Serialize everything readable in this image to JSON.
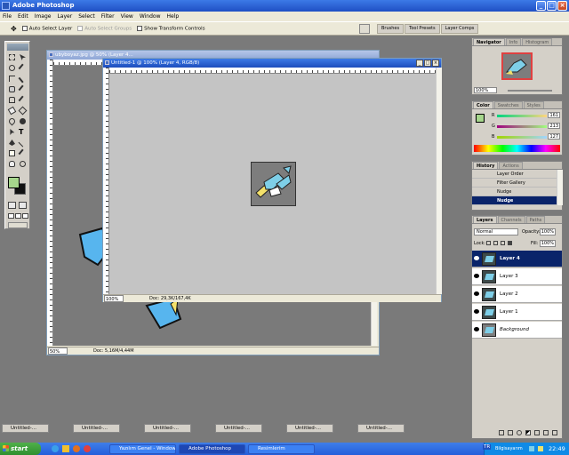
{
  "app": {
    "title": "Adobe Photoshop",
    "controls": {
      "min": "_",
      "max": "□",
      "close": "×"
    }
  },
  "menu": [
    "File",
    "Edit",
    "Image",
    "Layer",
    "Select",
    "Filter",
    "View",
    "Window",
    "Help"
  ],
  "options": {
    "auto_select_layer": "Auto Select Layer",
    "auto_select_groups": "Auto Select Groups",
    "show_transform_controls": "Show Transform Controls",
    "well_tabs": [
      "Brushes",
      "Tool Presets",
      "Layer Comps"
    ]
  },
  "colors": {
    "foreground": "#a6d68c",
    "background": "#111111",
    "canvas": "#c4c4c4",
    "selection": "#0a246a",
    "xp_blue": "#245edb",
    "art_cyan": "#7ecfe8",
    "art_yellow": "#f3e06a"
  },
  "doc_back": {
    "title": "ubyboyaz.jpg @ 50% (Layer 4...",
    "zoom": "50%",
    "doc": "Doc: 5,16M/4,44M"
  },
  "doc_front": {
    "title": "Untitled-1 @ 100% (Layer 4, RGB/8)",
    "zoom": "100%",
    "doc": "Doc: 29,3K/167,4K"
  },
  "navigator": {
    "tabs": [
      "Navigator",
      "Info",
      "Histogram"
    ],
    "zoom": "100%"
  },
  "color_panel": {
    "tabs": [
      "Color",
      "Swatches",
      "Styles"
    ],
    "channels": [
      {
        "label": "R",
        "value": "161"
      },
      {
        "label": "G",
        "value": "213"
      },
      {
        "label": "B",
        "value": "127"
      }
    ]
  },
  "history": {
    "tabs": [
      "History",
      "Actions"
    ],
    "items": [
      "Layer Order",
      "Filter Gallery",
      "Nudge",
      "Nudge"
    ]
  },
  "layers": {
    "tabs": [
      "Layers",
      "Channels",
      "Paths"
    ],
    "blend": "Normal",
    "opacity_label": "Opacity:",
    "opacity": "100%",
    "lock_label": "Lock:",
    "fill_label": "Fill:",
    "fill": "100%",
    "items": [
      "Layer 4",
      "Layer 3",
      "Layer 2",
      "Layer 1",
      "Background"
    ]
  },
  "minimized": [
    "Untitled-...",
    "Untitled-...",
    "Untitled-...",
    "Untitled-...",
    "Untitled-...",
    "Untitled-..."
  ],
  "taskbar": {
    "start": "start",
    "buttons": [
      "Yazılım Genel - Windows...",
      "Adobe Photoshop",
      "Resimlerim"
    ],
    "lang": "TR",
    "tray_label": "Bilgisayarım",
    "clock": "22:49"
  }
}
